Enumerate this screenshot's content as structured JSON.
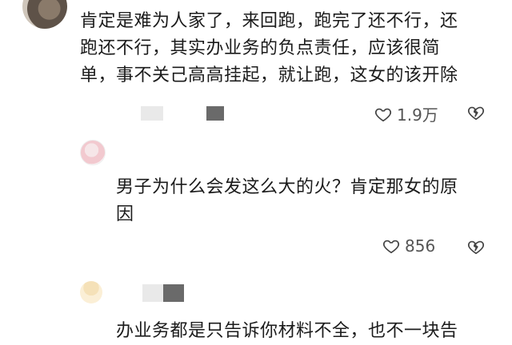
{
  "comments": [
    {
      "text": "肯定是难为人家了，来回跑，跑完了还不行，还\n跑还不行，其实办业务的负点责任，应该很简\n单，事不关己高高挂起，就让跑，这女的该开除",
      "likes": "1.9万"
    },
    {
      "text": "男子为什么会发这么大的火？肯定那女的原\n因",
      "likes": "856"
    },
    {
      "text": "办业务都是只告诉你材料不全，也不一块告"
    }
  ],
  "colors": {
    "text": "#1b1b1b",
    "meta": "#555555",
    "background": "#ffffff"
  },
  "icons": [
    "like-heart-icon",
    "dislike-broken-heart-icon"
  ]
}
